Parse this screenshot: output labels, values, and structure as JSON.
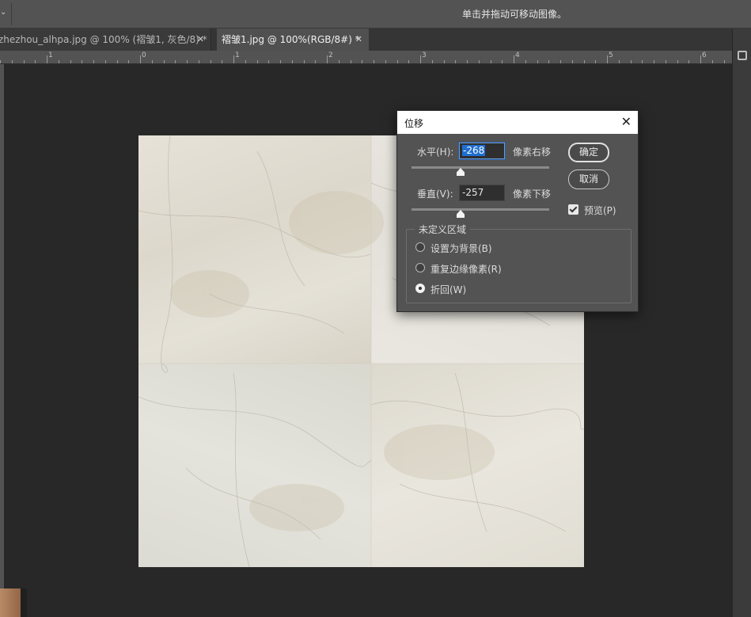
{
  "options_bar": {
    "menu_glyph": "⌄",
    "hint": "单击并拖动可移动图像。"
  },
  "tabs": [
    {
      "label": "zhezhou_alhpa.jpg @ 100% (褶皱1, 灰色/8) *",
      "close": "✕",
      "active": false
    },
    {
      "label": "褶皱1.jpg @ 100%(RGB/8#) *",
      "close": "✕",
      "active": true
    }
  ],
  "ruler": {
    "labels": [
      "1",
      "0",
      "1",
      "2",
      "3",
      "4",
      "5",
      "6"
    ]
  },
  "dialog": {
    "title": "位移",
    "close": "✕",
    "horizontal": {
      "label": "水平(H):",
      "value": "-268",
      "unit": "像素右移"
    },
    "vertical": {
      "label": "垂直(V):",
      "value": "-257",
      "unit": "像素下移"
    },
    "buttons": {
      "ok": "确定",
      "cancel": "取消"
    },
    "preview": {
      "label": "预览(P)",
      "checked": true
    },
    "undefined_area": {
      "legend": "未定义区域",
      "options": [
        {
          "label": "设置为背景(B)",
          "selected": false
        },
        {
          "label": "重复边缘像素(R)",
          "selected": false
        },
        {
          "label": "折回(W)",
          "selected": true
        }
      ]
    }
  },
  "icons": {
    "panel": "panel-icon",
    "preview_checkbox": "checkbox-checked-icon"
  }
}
